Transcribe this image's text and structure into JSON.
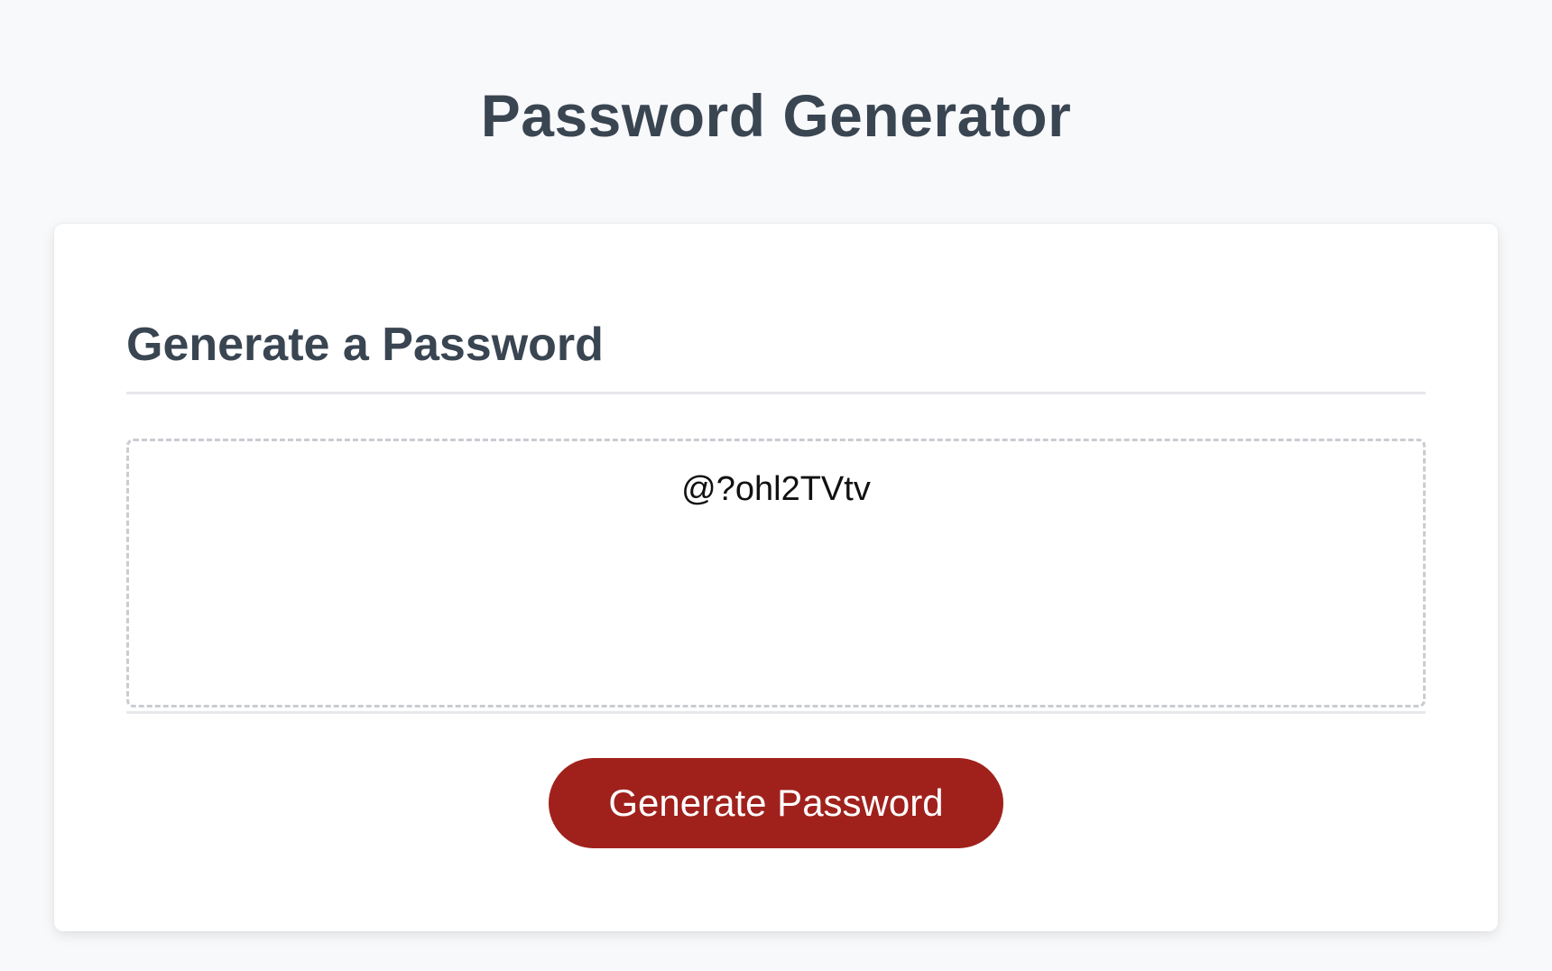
{
  "header": {
    "title": "Password Generator"
  },
  "card": {
    "title": "Generate a Password",
    "password_value": "@?ohl2TVtv",
    "generate_button_label": "Generate Password"
  },
  "colors": {
    "page_background": "#f8f9fb",
    "heading_text": "#3a4552",
    "button_background": "#a0211c",
    "button_text": "#ffffff"
  }
}
